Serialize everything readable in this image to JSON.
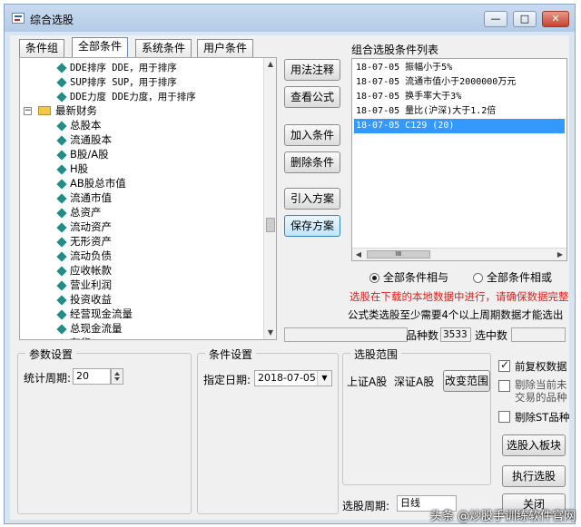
{
  "window": {
    "title": "综合选股",
    "minimize_glyph": "—",
    "maximize_glyph": "□",
    "close_glyph": "✕"
  },
  "tabs": [
    {
      "label": "条件组",
      "active": false
    },
    {
      "label": "全部条件",
      "active": true
    },
    {
      "label": "系统条件",
      "active": false
    },
    {
      "label": "用户条件",
      "active": false
    }
  ],
  "tree": {
    "items_top": [
      "DDE排序 DDE，用于排序",
      "SUP排序 SUP，用于排序",
      "DDE力度 DDE力度，用于排序"
    ],
    "folder_label": "最新财务",
    "folder_expander": "−",
    "items": [
      "总股本",
      "流通股本",
      "B股/A股",
      "H股",
      "AB股总市值",
      "流通市值",
      "总资产",
      "流动资产",
      "无形资产",
      "流动负债",
      "应收帐款",
      "营业利润",
      "投资收益",
      "经营现金流量",
      "总现金流量",
      "存货"
    ]
  },
  "middle_buttons": {
    "usage": "用法注释",
    "view_formula": "查看公式",
    "add_condition": "加入条件",
    "delete_condition": "删除条件",
    "import_plan": "引入方案",
    "save_plan": "保存方案"
  },
  "condition_list": {
    "label": "组合选股条件列表",
    "items": [
      {
        "text": "18-07-05 振幅小于5%",
        "selected": false
      },
      {
        "text": "18-07-05 流通市值小于2000000万元",
        "selected": false
      },
      {
        "text": "18-07-05 换手率大于3%",
        "selected": false
      },
      {
        "text": "18-07-05 量比(沪深)大于1.2倍",
        "selected": false
      },
      {
        "text": "18-07-05 C129 (20)",
        "selected": true
      }
    ],
    "scroll_grip": "III"
  },
  "logic": {
    "and_label": "全部条件相与",
    "or_label": "全部条件相或",
    "selected": "and"
  },
  "messages": {
    "warning": "选股在下载的本地数据中进行，请确保数据完整",
    "note": "公式类选股至少需要4个以上周期数据才能选出"
  },
  "stats": {
    "count_label": "品种数",
    "count_value": "3533",
    "selected_label": "选中数",
    "selected_value": ""
  },
  "params": {
    "title": "参数设置",
    "period_label": "统计周期:",
    "period_value": "20"
  },
  "condition_settings": {
    "title": "条件设置",
    "date_label": "指定日期:",
    "date_value": "2018-07-05"
  },
  "scope": {
    "title": "选股范围",
    "shanghai_a": "上证A股",
    "shenzhen_a": "深证A股",
    "change_button": "改变范围",
    "period_label": "选股周期:",
    "period_value": "日线"
  },
  "options": {
    "adjust_label": "前复权数据",
    "adjust_checked": true,
    "exclude_untraded_label": "剔除当前未交易的品种",
    "exclude_untraded_checked": false,
    "exclude_st_label": "剔除ST品种",
    "exclude_st_checked": false
  },
  "bottom_buttons": {
    "to_board": "选股入板块",
    "execute": "执行选股",
    "close": "关闭"
  },
  "watermark": "头条 @炒股手训练软件官网",
  "icons": {
    "tree_leaf": "diamond-bullet-icon",
    "tree_folder": "folder-icon",
    "dropdown": "chevron-down-icon"
  },
  "colors": {
    "warning_text": "#e0201c",
    "selection": "#3399ff",
    "bullet": "#1f8f86"
  }
}
